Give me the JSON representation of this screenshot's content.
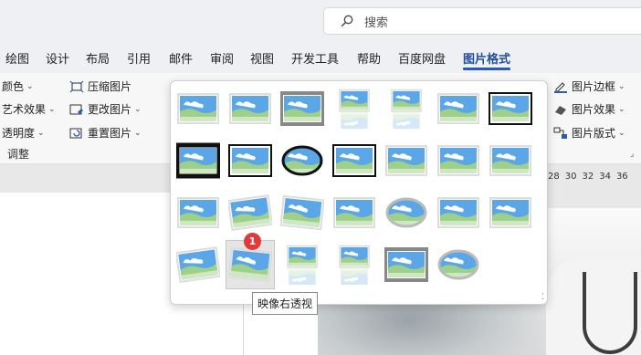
{
  "search": {
    "placeholder": "搜索"
  },
  "tabs": [
    {
      "label": "绘图"
    },
    {
      "label": "设计"
    },
    {
      "label": "布局"
    },
    {
      "label": "引用"
    },
    {
      "label": "邮件"
    },
    {
      "label": "审阅"
    },
    {
      "label": "视图"
    },
    {
      "label": "开发工具"
    },
    {
      "label": "帮助"
    },
    {
      "label": "百度网盘"
    },
    {
      "label": "图片格式"
    }
  ],
  "active_tab": "图片格式",
  "ribbon": {
    "color": "颜色",
    "artistic": "艺术效果",
    "transparency": "透明度",
    "compress": "压缩图片",
    "change": "更改图片",
    "reset": "重置图片",
    "adjust_group": "调整",
    "picture_border": "图片边框",
    "picture_effects": "图片效果",
    "picture_layout": "图片版式"
  },
  "ruler": [
    "28",
    "30",
    "32",
    "34",
    "36"
  ],
  "gallery": {
    "styles": [
      {
        "name": "simple-frame-white"
      },
      {
        "name": "beveled-matte-white"
      },
      {
        "name": "metal-frame"
      },
      {
        "name": "drop-shadow-rectangle"
      },
      {
        "name": "reflected-rounded-rectangle"
      },
      {
        "name": "soft-edge-rectangle"
      },
      {
        "name": "double-frame-black"
      },
      {
        "name": "thick-matte-black"
      },
      {
        "name": "simple-frame-black"
      },
      {
        "name": "beveled-oval-black"
      },
      {
        "name": "compound-frame-black"
      },
      {
        "name": "center-shadow-rectangle"
      },
      {
        "name": "rounded-diagonal-corner-white"
      },
      {
        "name": "snip-diagonal-corner-white"
      },
      {
        "name": "moderate-frame-white"
      },
      {
        "name": "rotated-white"
      },
      {
        "name": "perspective-shadow-white"
      },
      {
        "name": "relaxed-perspective-white"
      },
      {
        "name": "soft-edge-oval"
      },
      {
        "name": "bevel-rectangle"
      },
      {
        "name": "bevel-perspective"
      },
      {
        "name": "reflected-bevel-white"
      },
      {
        "name": "bevel-perspective-left-white"
      },
      {
        "name": "reflected-perspective-right"
      },
      {
        "name": "bevel-rectangle-reflected"
      },
      {
        "name": "metal-rounded-rectangle"
      },
      {
        "name": "metal-oval"
      }
    ],
    "selected_index": 22,
    "badge": "1",
    "tooltip": "映像右透视"
  },
  "colors": {
    "accent": "#2a5bb4",
    "badge": "#e03a3a"
  }
}
